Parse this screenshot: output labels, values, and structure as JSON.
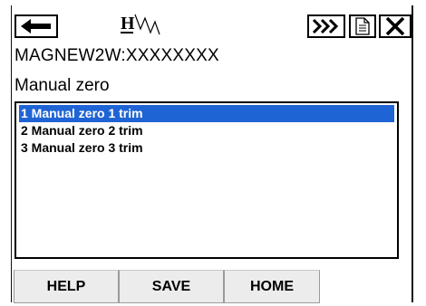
{
  "toolbar": {
    "back_icon": "left-arrow-icon",
    "logo_icon": "hart-logo",
    "logo_text": "H",
    "forward_icon": "fast-forward-icon",
    "document_icon": "document-icon",
    "close_icon": "close-icon"
  },
  "device_tag": "MAGNEW2W:XXXXXXXX",
  "screen_title": "Manual zero",
  "menu": {
    "items": [
      {
        "label": "1 Manual zero 1 trim",
        "selected": true
      },
      {
        "label": "2 Manual zero 2 trim",
        "selected": false
      },
      {
        "label": "3 Manual zero 3 trim",
        "selected": false
      }
    ]
  },
  "buttons": {
    "help": "HELP",
    "save": "SAVE",
    "home": "HOME"
  },
  "colors": {
    "selection": "#1f64d4",
    "button_bg": "#ececec"
  }
}
